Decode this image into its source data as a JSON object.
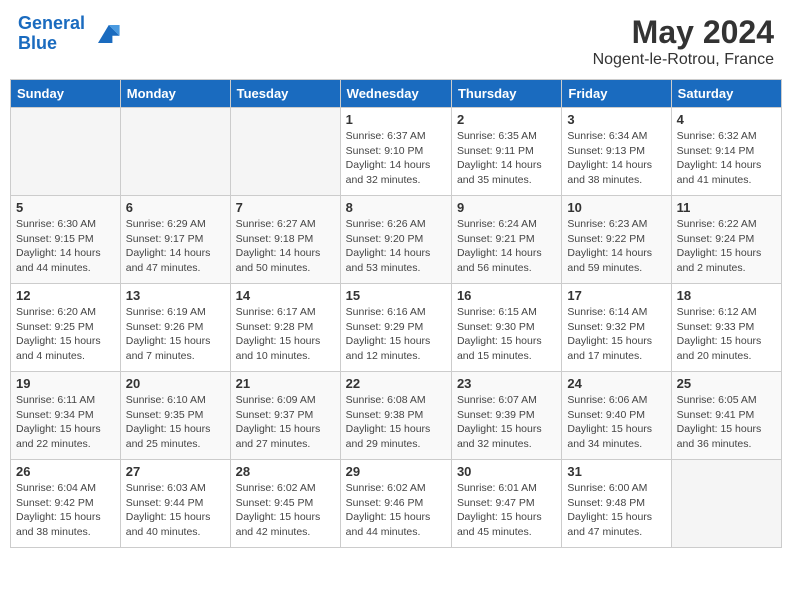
{
  "header": {
    "logo_line1": "General",
    "logo_line2": "Blue",
    "month": "May 2024",
    "location": "Nogent-le-Rotrou, France"
  },
  "weekdays": [
    "Sunday",
    "Monday",
    "Tuesday",
    "Wednesday",
    "Thursday",
    "Friday",
    "Saturday"
  ],
  "weeks": [
    [
      {
        "day": "",
        "info": ""
      },
      {
        "day": "",
        "info": ""
      },
      {
        "day": "",
        "info": ""
      },
      {
        "day": "1",
        "info": "Sunrise: 6:37 AM\nSunset: 9:10 PM\nDaylight: 14 hours\nand 32 minutes."
      },
      {
        "day": "2",
        "info": "Sunrise: 6:35 AM\nSunset: 9:11 PM\nDaylight: 14 hours\nand 35 minutes."
      },
      {
        "day": "3",
        "info": "Sunrise: 6:34 AM\nSunset: 9:13 PM\nDaylight: 14 hours\nand 38 minutes."
      },
      {
        "day": "4",
        "info": "Sunrise: 6:32 AM\nSunset: 9:14 PM\nDaylight: 14 hours\nand 41 minutes."
      }
    ],
    [
      {
        "day": "5",
        "info": "Sunrise: 6:30 AM\nSunset: 9:15 PM\nDaylight: 14 hours\nand 44 minutes."
      },
      {
        "day": "6",
        "info": "Sunrise: 6:29 AM\nSunset: 9:17 PM\nDaylight: 14 hours\nand 47 minutes."
      },
      {
        "day": "7",
        "info": "Sunrise: 6:27 AM\nSunset: 9:18 PM\nDaylight: 14 hours\nand 50 minutes."
      },
      {
        "day": "8",
        "info": "Sunrise: 6:26 AM\nSunset: 9:20 PM\nDaylight: 14 hours\nand 53 minutes."
      },
      {
        "day": "9",
        "info": "Sunrise: 6:24 AM\nSunset: 9:21 PM\nDaylight: 14 hours\nand 56 minutes."
      },
      {
        "day": "10",
        "info": "Sunrise: 6:23 AM\nSunset: 9:22 PM\nDaylight: 14 hours\nand 59 minutes."
      },
      {
        "day": "11",
        "info": "Sunrise: 6:22 AM\nSunset: 9:24 PM\nDaylight: 15 hours\nand 2 minutes."
      }
    ],
    [
      {
        "day": "12",
        "info": "Sunrise: 6:20 AM\nSunset: 9:25 PM\nDaylight: 15 hours\nand 4 minutes."
      },
      {
        "day": "13",
        "info": "Sunrise: 6:19 AM\nSunset: 9:26 PM\nDaylight: 15 hours\nand 7 minutes."
      },
      {
        "day": "14",
        "info": "Sunrise: 6:17 AM\nSunset: 9:28 PM\nDaylight: 15 hours\nand 10 minutes."
      },
      {
        "day": "15",
        "info": "Sunrise: 6:16 AM\nSunset: 9:29 PM\nDaylight: 15 hours\nand 12 minutes."
      },
      {
        "day": "16",
        "info": "Sunrise: 6:15 AM\nSunset: 9:30 PM\nDaylight: 15 hours\nand 15 minutes."
      },
      {
        "day": "17",
        "info": "Sunrise: 6:14 AM\nSunset: 9:32 PM\nDaylight: 15 hours\nand 17 minutes."
      },
      {
        "day": "18",
        "info": "Sunrise: 6:12 AM\nSunset: 9:33 PM\nDaylight: 15 hours\nand 20 minutes."
      }
    ],
    [
      {
        "day": "19",
        "info": "Sunrise: 6:11 AM\nSunset: 9:34 PM\nDaylight: 15 hours\nand 22 minutes."
      },
      {
        "day": "20",
        "info": "Sunrise: 6:10 AM\nSunset: 9:35 PM\nDaylight: 15 hours\nand 25 minutes."
      },
      {
        "day": "21",
        "info": "Sunrise: 6:09 AM\nSunset: 9:37 PM\nDaylight: 15 hours\nand 27 minutes."
      },
      {
        "day": "22",
        "info": "Sunrise: 6:08 AM\nSunset: 9:38 PM\nDaylight: 15 hours\nand 29 minutes."
      },
      {
        "day": "23",
        "info": "Sunrise: 6:07 AM\nSunset: 9:39 PM\nDaylight: 15 hours\nand 32 minutes."
      },
      {
        "day": "24",
        "info": "Sunrise: 6:06 AM\nSunset: 9:40 PM\nDaylight: 15 hours\nand 34 minutes."
      },
      {
        "day": "25",
        "info": "Sunrise: 6:05 AM\nSunset: 9:41 PM\nDaylight: 15 hours\nand 36 minutes."
      }
    ],
    [
      {
        "day": "26",
        "info": "Sunrise: 6:04 AM\nSunset: 9:42 PM\nDaylight: 15 hours\nand 38 minutes."
      },
      {
        "day": "27",
        "info": "Sunrise: 6:03 AM\nSunset: 9:44 PM\nDaylight: 15 hours\nand 40 minutes."
      },
      {
        "day": "28",
        "info": "Sunrise: 6:02 AM\nSunset: 9:45 PM\nDaylight: 15 hours\nand 42 minutes."
      },
      {
        "day": "29",
        "info": "Sunrise: 6:02 AM\nSunset: 9:46 PM\nDaylight: 15 hours\nand 44 minutes."
      },
      {
        "day": "30",
        "info": "Sunrise: 6:01 AM\nSunset: 9:47 PM\nDaylight: 15 hours\nand 45 minutes."
      },
      {
        "day": "31",
        "info": "Sunrise: 6:00 AM\nSunset: 9:48 PM\nDaylight: 15 hours\nand 47 minutes."
      },
      {
        "day": "",
        "info": ""
      }
    ]
  ]
}
